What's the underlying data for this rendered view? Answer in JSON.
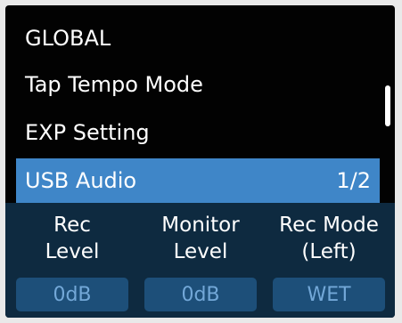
{
  "menu": {
    "items": [
      {
        "label": "GLOBAL"
      },
      {
        "label": "Tap Tempo Mode"
      },
      {
        "label": "EXP Setting"
      },
      {
        "label": "USB Audio",
        "page": "1/2",
        "selected": true
      }
    ]
  },
  "params": [
    {
      "label_line1": "Rec",
      "label_line2": "Level",
      "value": "0dB"
    },
    {
      "label_line1": "Monitor",
      "label_line2": "Level",
      "value": "0dB"
    },
    {
      "label_line1": "Rec Mode",
      "label_line2": "(Left)",
      "value": "WET"
    }
  ],
  "colors": {
    "background": "#020202",
    "selected": "#3f86c8",
    "panel": "#0e2a40",
    "value_box": "#1d4f79",
    "value_text": "#73a8d8"
  }
}
